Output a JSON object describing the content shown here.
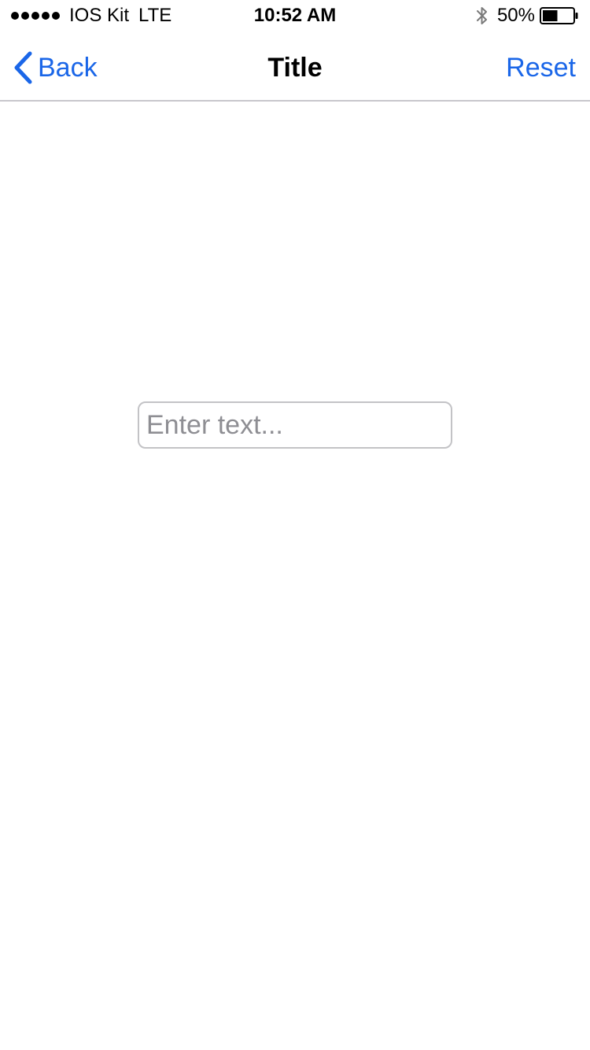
{
  "status_bar": {
    "carrier": "IOS Kit",
    "network": "LTE",
    "time": "10:52 AM",
    "battery_percent": "50%",
    "battery_level": 0.5,
    "icons": [
      "signal-dots",
      "bluetooth-icon",
      "battery-icon"
    ]
  },
  "nav": {
    "back_label": "Back",
    "title": "Title",
    "reset_label": "Reset",
    "back_icon": "chevron-left-icon"
  },
  "main": {
    "text_field": {
      "value": "",
      "placeholder": "Enter text..."
    }
  },
  "colors": {
    "accent": "#1a66e8",
    "separator": "#c8c7cc",
    "placeholder": "#8e8e93",
    "field_border": "#c3c3c6"
  }
}
